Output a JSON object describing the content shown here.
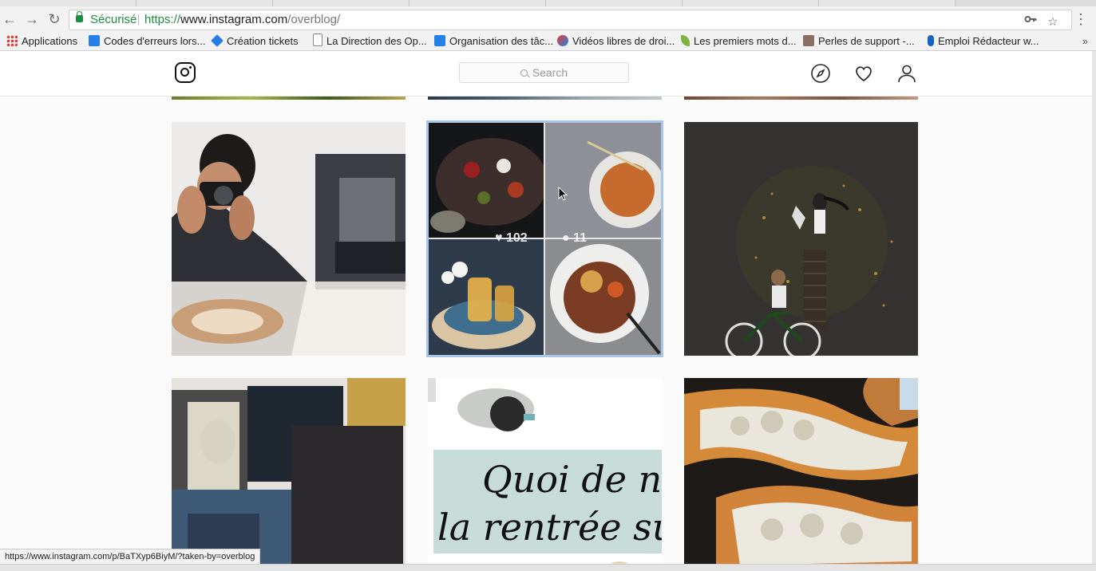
{
  "browser": {
    "security_label": "Sécurisé",
    "url_scheme": "https://",
    "url_host": "www.instagram.com",
    "url_path": "/overblog/",
    "bookmarks": [
      {
        "label": "Applications"
      },
      {
        "label": "Codes d'erreurs lors..."
      },
      {
        "label": "Création tickets"
      },
      {
        "label": "La Direction des Op..."
      },
      {
        "label": "Organisation des tâc..."
      },
      {
        "label": "Vidéos libres de droi..."
      },
      {
        "label": "Les premiers mots d..."
      },
      {
        "label": "Perles de support -..."
      },
      {
        "label": "Emploi Rédacteur w..."
      }
    ],
    "more_bookmarks": "»",
    "status_url": "https://www.instagram.com/p/BaTXyp6BiyM/?taken-by=overblog"
  },
  "instagram": {
    "search_placeholder": "Search",
    "hovered_post": {
      "likes": "102",
      "comments": "11"
    },
    "post_text": {
      "line1": "Quoi de neuf p",
      "line2": "la rentrée sur Ove"
    }
  },
  "colors": {
    "secure_green": "#1e8e3e",
    "selection_outline": "#a7c7ea"
  }
}
